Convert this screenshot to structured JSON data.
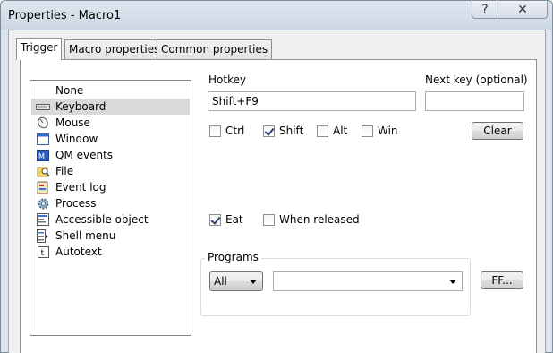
{
  "window": {
    "title": "Properties - Macro1",
    "help_glyph": "?",
    "close_glyph": "✕"
  },
  "tabs": [
    {
      "label": "Trigger",
      "active": true
    },
    {
      "label": "Macro properties",
      "active": false
    },
    {
      "label": "Common properties",
      "active": false
    }
  ],
  "triggers": {
    "selected": "Keyboard",
    "items": [
      {
        "label": "None",
        "icon": "none"
      },
      {
        "label": "Keyboard",
        "icon": "keyboard-icon"
      },
      {
        "label": "Mouse",
        "icon": "mouse-icon"
      },
      {
        "label": "Window",
        "icon": "window-icon"
      },
      {
        "label": "QM events",
        "icon": "qm-events-icon"
      },
      {
        "label": "File",
        "icon": "file-search-icon"
      },
      {
        "label": "Event log",
        "icon": "event-log-icon"
      },
      {
        "label": "Process",
        "icon": "process-gear-icon"
      },
      {
        "label": "Accessible object",
        "icon": "accessible-object-icon"
      },
      {
        "label": "Shell menu",
        "icon": "shell-menu-icon"
      },
      {
        "label": "Autotext",
        "icon": "autotext-icon"
      }
    ]
  },
  "hotkey": {
    "label": "Hotkey",
    "value": "Shift+F9",
    "next_key_label": "Next key (optional)",
    "next_key_value": ""
  },
  "modifiers": [
    {
      "label": "Ctrl",
      "checked": false
    },
    {
      "label": "Shift",
      "checked": true
    },
    {
      "label": "Alt",
      "checked": false
    },
    {
      "label": "Win",
      "checked": false
    }
  ],
  "clear_button": "Clear",
  "options": [
    {
      "label": "Eat",
      "checked": true
    },
    {
      "label": "When released",
      "checked": false
    }
  ],
  "programs": {
    "group_label": "Programs",
    "scope_value": "All",
    "program_value": "",
    "ff_button": "FF..."
  }
}
